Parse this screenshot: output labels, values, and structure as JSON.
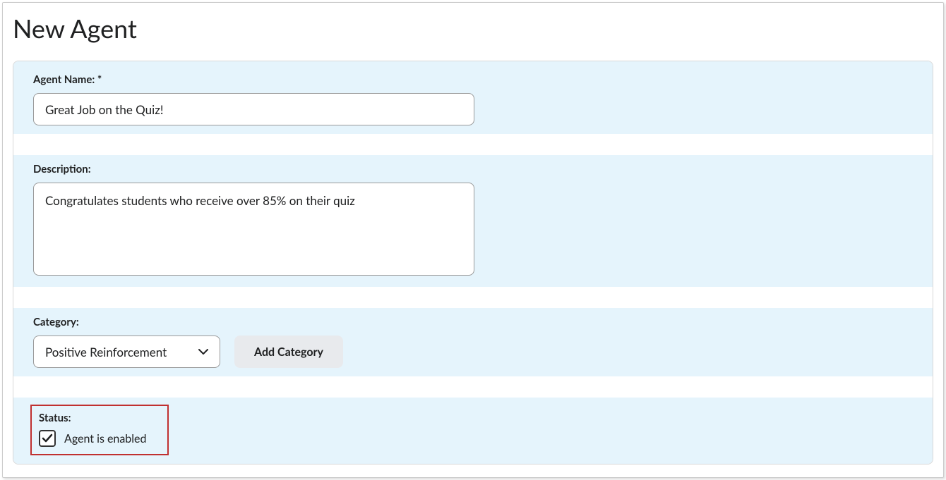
{
  "page_title": "New Agent",
  "form": {
    "agent_name": {
      "label": "Agent Name: *",
      "value": "Great Job on the Quiz!"
    },
    "description": {
      "label": "Description:",
      "value": "Congratulates students who receive over 85% on their quiz"
    },
    "category": {
      "label": "Category:",
      "selected": "Positive Reinforcement",
      "add_button": "Add Category"
    },
    "status": {
      "label": "Status:",
      "checkbox_label": "Agent is enabled",
      "checked": true
    }
  }
}
